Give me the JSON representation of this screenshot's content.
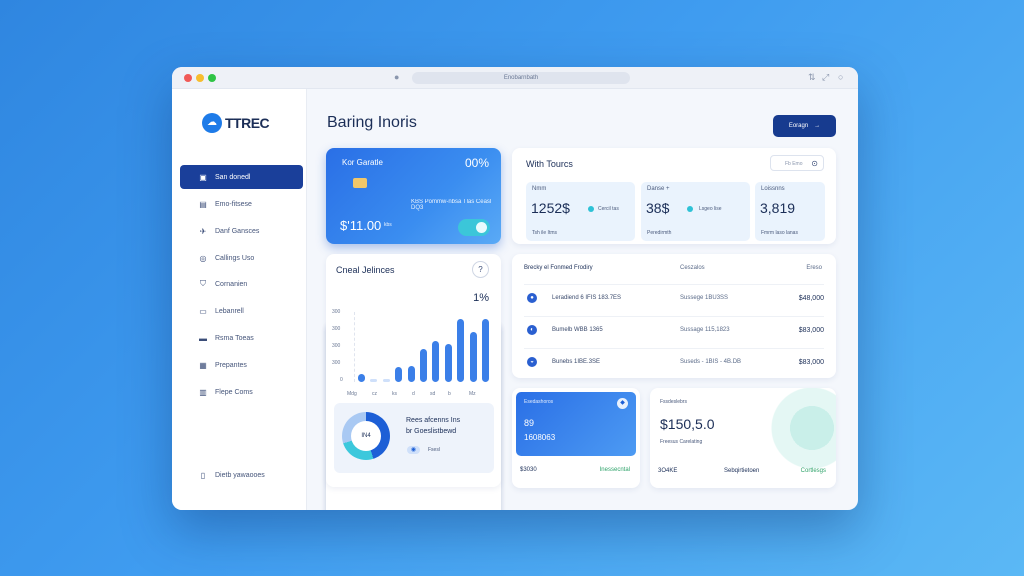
{
  "window": {
    "url": "Enobarnbath",
    "titlebar_icons": [
      "split-icon",
      "expand-icon",
      "circle-icon"
    ]
  },
  "sidebar": {
    "logo": "TTREC",
    "items": [
      {
        "label": "San donedl",
        "icon": "wallet-icon",
        "active": true
      },
      {
        "label": "Emo-fitsese",
        "icon": "document-icon"
      },
      {
        "label": "Danf Gansces",
        "icon": "plane-icon"
      },
      {
        "label": "Callings Uso",
        "icon": "settings-icon"
      },
      {
        "label": "Cornanien",
        "icon": "shield-icon"
      },
      {
        "label": "Lebanrell",
        "icon": "folder-icon"
      },
      {
        "label": "Rsma Toeas",
        "icon": "card-icon"
      },
      {
        "label": "Prepantes",
        "icon": "list-icon"
      },
      {
        "label": "Flepe Coms",
        "icon": "chart-icon"
      }
    ],
    "footer": "Dietb yawaooes"
  },
  "header": {
    "title": "Baring Inoris",
    "button_label": "Eoragn"
  },
  "blue_card": {
    "label": "Kor Garatle",
    "percent": "00%",
    "card_number": "KBS Pommw-nbsa Tlas Ceasl DQ3",
    "amount": "$'11.00",
    "amount_sub": "kbs"
  },
  "with_tours": {
    "title": "With Tourcs",
    "search_placeholder": "Fb Emo",
    "boxes": [
      {
        "label": "Nmm",
        "value": "1252$",
        "extra": "Cercil tas",
        "foot": "Tsh ile Itms"
      },
      {
        "label": "Danse +",
        "value": "38$",
        "extra": "Lsgeo lise",
        "foot": "Peredirmth"
      },
      {
        "label": "Loissnns",
        "value": "3,819",
        "extra": "",
        "foot": "Fmrm laso lanas"
      }
    ]
  },
  "credit_card": {
    "title": "Cneal Jelinces",
    "help": "?",
    "percent": "1%",
    "donut_label": "IN4"
  },
  "chart_data": {
    "type": "bar",
    "title": "",
    "ytick_labels": [
      "300",
      "300",
      "300",
      "300",
      "0"
    ],
    "xtick_labels": [
      "Mdg",
      "cz",
      "ks",
      "d",
      "sd",
      "b",
      "Mz"
    ],
    "values": [
      12,
      4,
      0,
      22,
      23,
      47,
      58,
      54,
      90,
      72,
      90
    ],
    "ylim": [
      0,
      100
    ]
  },
  "promo": {
    "line1": "Rees afcenns Ins",
    "line2": "br Goeslistbewd",
    "link": "Fsesl"
  },
  "transactions": {
    "header": "Brecky el Fonmed Frodiry",
    "col_date": "Ceszalos",
    "col_amount": "Ereso",
    "rows": [
      {
        "name": "Leradiend 6 IFIS 183.7ES",
        "date": "Sussege 1BU3SS",
        "amount": "$48,000"
      },
      {
        "name": "Bumelb WBB 1365",
        "date": "Sussage 115,1823",
        "amount": "$83,000"
      },
      {
        "name": "Bunebs 1IBE.3SE",
        "date": "Suseds - 1BIS - 4B.DB",
        "amount": "$83,000"
      }
    ]
  },
  "blue_mini": {
    "label": "Esedashoros",
    "line1": "89",
    "line2": "1608063",
    "foot_left": "$3030",
    "foot_right": "Inessecntal"
  },
  "balance": {
    "label": "Fssdeslebrs",
    "amount": "$150,5.0",
    "sub": "Freesus Carelating",
    "foot1": "3O4KE",
    "foot2": "Sebqirtietoen",
    "foot3": "Cortlesgs"
  },
  "colors": {
    "accent": "#1a3f9a",
    "bar": "#3b7fe8",
    "positive": "#2ea36a"
  }
}
